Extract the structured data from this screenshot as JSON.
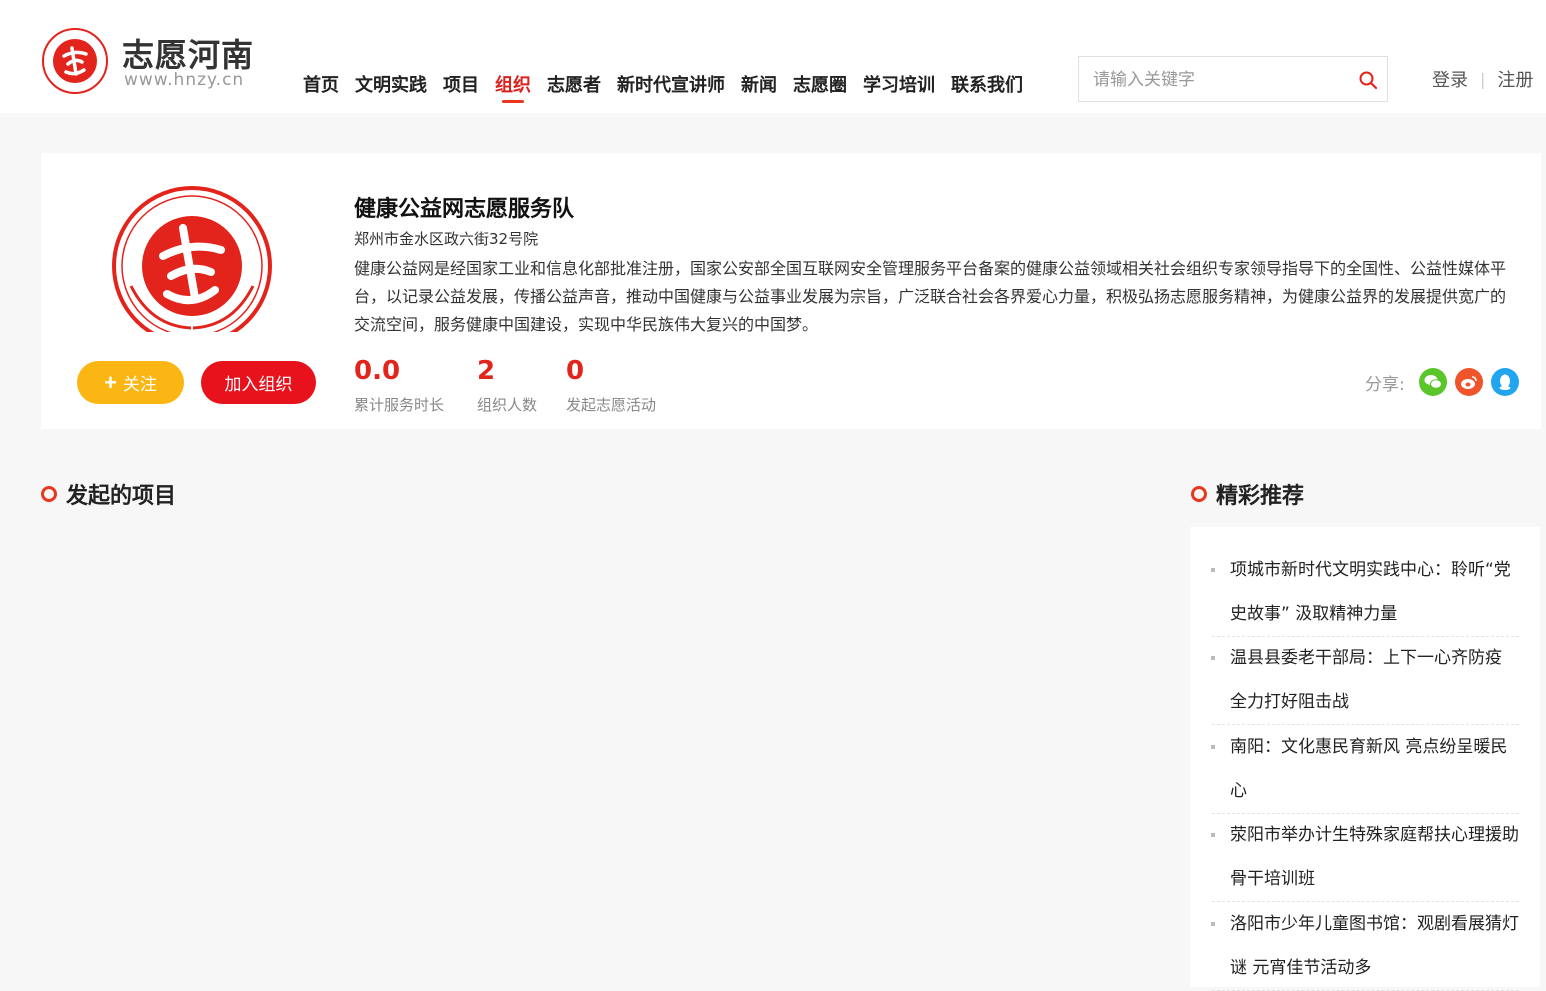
{
  "header": {
    "site_name": "志愿河南",
    "site_url": "www.hnzy.cn",
    "nav": [
      {
        "label": "首页"
      },
      {
        "label": "文明实践"
      },
      {
        "label": "项目"
      },
      {
        "label": "组织",
        "active": true
      },
      {
        "label": "志愿者"
      },
      {
        "label": "新时代宣讲师"
      },
      {
        "label": "新闻"
      },
      {
        "label": "志愿圈"
      },
      {
        "label": "学习培训"
      },
      {
        "label": "联系我们"
      }
    ],
    "search_placeholder": "请输入关键字",
    "login": "登录",
    "register": "注册",
    "divider": "|"
  },
  "org": {
    "name": "健康公益网志愿服务队",
    "address": "郑州市金水区政六街32号院",
    "description": "健康公益网是经国家工业和信息化部批准注册，国家公安部全国互联网安全管理服务平台备案的健康公益领域相关社会组织专家领导指导下的全国性、公益性媒体平台，以记录公益发展，传播公益声音，推动中国健康与公益事业发展为宗旨，广泛联合社会各界爱心力量，积极弘扬志愿服务精神，为健康公益界的发展提供宽广的交流空间，服务健康中国建设，实现中华民族伟大复兴的中国梦。",
    "follow_label": "关注",
    "join_label": "加入组织",
    "stats": [
      {
        "value": "0.0",
        "label": "累计服务时长"
      },
      {
        "value": "2",
        "label": "组织人数"
      },
      {
        "value": "0",
        "label": "发起志愿活动"
      }
    ],
    "share_label": "分享:",
    "share_icons": [
      "wechat-icon",
      "weibo-icon",
      "qq-icon"
    ]
  },
  "sections": {
    "projects_title": "发起的项目",
    "recommend_title": "精彩推荐"
  },
  "recommendations": [
    "项城市新时代文明实践中心：聆听“党史故事” 汲取精神力量",
    "温县县委老干部局：上下一心齐防疫 全力打好阻击战",
    "南阳：文化惠民育新风 亮点纷呈暖民心",
    "荥阳市举办计生特殊家庭帮扶心理援助骨干培训班",
    "洛阳市少年儿童图书馆：观剧看展猜灯谜 元宵佳节活动多"
  ],
  "colors": {
    "brand_red": "#e3241c",
    "follow_yellow": "#fbb613",
    "join_red": "#e8121d"
  }
}
